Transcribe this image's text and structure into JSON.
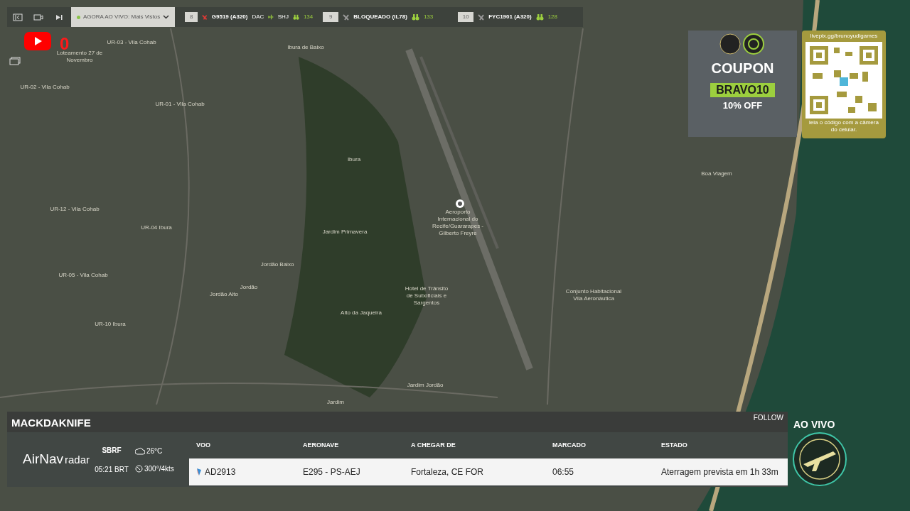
{
  "live_selector": {
    "prefix": "AGORA AO VIVO:",
    "value": "Mais Vistos"
  },
  "flights": [
    {
      "rank": "8",
      "callsign": "G9519",
      "type": "(A320)",
      "origin": "DAC",
      "destination": "SHJ",
      "viewers": "134"
    },
    {
      "rank": "9",
      "callsign": "BLOQUEADO",
      "type": "(IL78)",
      "viewers": "133"
    },
    {
      "rank": "10",
      "callsign": "FYC1901",
      "type": "(A320)",
      "viewers": "128"
    }
  ],
  "youtube_count": "0",
  "map_labels": [
    "UR-03 - Vila Cohab",
    "Loteamento 27 de Novembro",
    "Ibura de Baixo",
    "UR-02 - Vila Cohab",
    "UR-01 - Vila Cohab",
    "Ibura",
    "UR-12 - Vila Cohab",
    "UR-04 Ibura",
    "Jardim Primavera",
    "Aeroporto Internacional do Recife/Guararapes - Gilberto Freyre",
    "Jordão Baixo",
    "UR-05 - Vila Cohab",
    "Jordão",
    "Jordão Alto",
    "Hotel de Trânsito de Suboficiais e Sargentos",
    "Conjunto Habitacional Vila Aeronáutica",
    "UR-10 Ibura",
    "Alto da Jaqueira",
    "Boa Viagem",
    "Jardim Jordão",
    "Jardim"
  ],
  "coupon": {
    "title": "COUPON",
    "code": "BRAVO10",
    "discount": "10% OFF"
  },
  "qr": {
    "url": "livepix.gg/brunoyudigames",
    "caption": "leia o código com a câmera do celular."
  },
  "flight_panel": {
    "username": "MACKDAKNIFE",
    "follow": "FOLLOW",
    "brand": "AirNav",
    "product": "radar",
    "airport": "SBRF",
    "time": "05:21 BRT",
    "temperature": "26°C",
    "wind": "300°/4kts",
    "columns": [
      "VOO",
      "AERONAVE",
      "A CHEGAR DE",
      "MARCADO",
      "ESTADO"
    ],
    "row": [
      "AD2913",
      "E295 - PS-AEJ",
      "Fortaleza, CE FOR",
      "06:55",
      "Aterragem prevista em 1h 33m"
    ]
  },
  "live_badge": "AO VIVO"
}
